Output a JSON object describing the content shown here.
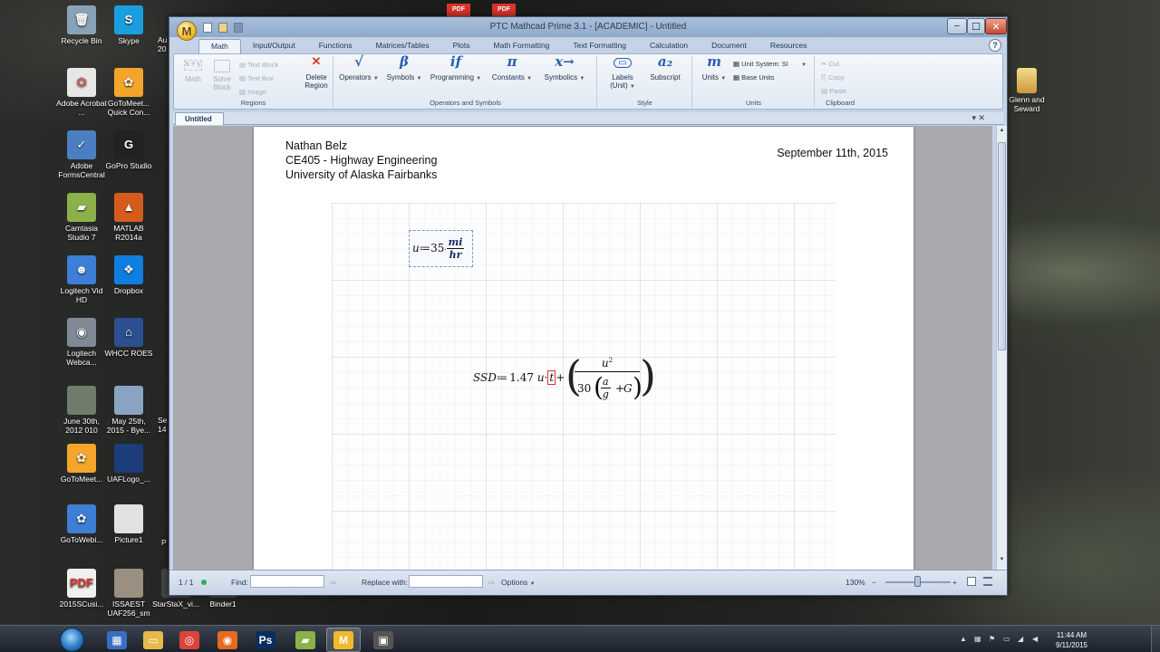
{
  "desktop_icons": [
    {
      "label": "Recycle Bin",
      "icon": "recycle-bin-icon",
      "color": "#8aa2b8",
      "glyph": "🗑"
    },
    {
      "label": "Skype",
      "icon": "skype-icon",
      "color": "#1b9ee0",
      "glyph": "S"
    },
    {
      "label": "Adobe Acrobat ...",
      "icon": "acrobat-icon",
      "color": "#e7e7e7",
      "glyph": "⏣"
    },
    {
      "label": "GoToMeet... Quick Con...",
      "icon": "gotomeeting-flower-icon",
      "color": "#f4a62a",
      "glyph": "✿"
    },
    {
      "label": "Adobe FormsCentral",
      "icon": "formscentral-icon",
      "color": "#4b7fc2",
      "glyph": "✓"
    },
    {
      "label": "GoPro Studio",
      "icon": "gopro-icon",
      "color": "#222222",
      "glyph": "G"
    },
    {
      "label": "Camtasia Studio 7",
      "icon": "camtasia-icon",
      "color": "#8cb04a",
      "glyph": "▰"
    },
    {
      "label": "MATLAB R2014a",
      "icon": "matlab-icon",
      "color": "#d65c1e",
      "glyph": "▲"
    },
    {
      "label": "Logitech Vid HD",
      "icon": "logitech-vid-icon",
      "color": "#3d7fd6",
      "glyph": "☻"
    },
    {
      "label": "Dropbox",
      "icon": "dropbox-icon",
      "color": "#0e7fe0",
      "glyph": "❖"
    },
    {
      "label": "Logitech Webca...",
      "icon": "webcam-icon",
      "color": "#7f8a96",
      "glyph": "◉"
    },
    {
      "label": "WHCC ROES",
      "icon": "whcc-roes-icon",
      "color": "#2b4f90",
      "glyph": "⌂"
    },
    {
      "label": "June 30th, 2012 010",
      "icon": "photo-thumbnail-icon",
      "color": "#6f7d6a",
      "glyph": ""
    },
    {
      "label": "May 25th, 2015 - Bye...",
      "icon": "photo-thumbnail-icon",
      "color": "#8aa3c0",
      "glyph": ""
    },
    {
      "label": "GoToMeet...",
      "icon": "gotomeeting-flower-icon",
      "color": "#f4a62a",
      "glyph": "✿"
    },
    {
      "label": "UAFLogo_...",
      "icon": "uaf-logo-icon",
      "color": "#1c3d7a",
      "glyph": ""
    },
    {
      "label": "GoToWebi...",
      "icon": "gotowebinar-icon",
      "color": "#3e7ed4",
      "glyph": "✿"
    },
    {
      "label": "Picture1",
      "icon": "picture-thumbnail-icon",
      "color": "#e2e2e2",
      "glyph": ""
    },
    {
      "label": "2015SCusi...",
      "icon": "pdf-file-icon",
      "color": "#f0f0f0",
      "glyph": "PDF"
    },
    {
      "label": "ISSAEST UAF256_sm",
      "icon": "person-photo-icon",
      "color": "#9a8f80",
      "glyph": ""
    },
    {
      "label": "StarStaX_vi...",
      "icon": "file-icon",
      "color": "#444444",
      "glyph": ""
    },
    {
      "label": "Binder1",
      "icon": "file-icon",
      "color": "#444444",
      "glyph": ""
    }
  ],
  "desktop_partial_labels": {
    "au": "Au",
    "num_20": "20",
    "se": "Se",
    "n14": "14",
    "p": "P"
  },
  "right_desktop_icon": {
    "label": "Glenn and Seward",
    "icon": "folder-icon"
  },
  "top_pdf_labels": [
    "PDF",
    "PDF"
  ],
  "window": {
    "title": "PTC Mathcad Prime 3.1 - [ACADEMIC] - Untitled",
    "logo_letter": "M",
    "help_glyph": "?",
    "controls": {
      "minimize": "−",
      "maximize": "☐",
      "close": "✕"
    },
    "tabs": [
      "Math",
      "Input/Output",
      "Functions",
      "Matrices/Tables",
      "Plots",
      "Math Formatting",
      "Text Formatting",
      "Calculation",
      "Document",
      "Resources"
    ],
    "active_tab": "Math"
  },
  "ribbon": {
    "regions": {
      "label": "Regions",
      "math": "Math",
      "solve_block": "Solve Block",
      "text_block": "Text Block",
      "text_box": "Text Box",
      "image": "Image",
      "delete_region": "Delete Region"
    },
    "operators": {
      "label": "Operators and Symbols",
      "operators": "Operators",
      "symbols": "Symbols",
      "programming": "Programming",
      "constants": "Constants",
      "symbolics": "Symbolics",
      "glyphs": {
        "operators": "√",
        "symbols": "β",
        "programming": "if",
        "constants": "π",
        "symbolics": "x→"
      }
    },
    "style": {
      "label": "Style",
      "labels": "Labels (Unit)",
      "subscript": "Subscript",
      "subscript_glyph": "a₂"
    },
    "units": {
      "label": "Units",
      "units": "Units",
      "units_glyph": "m",
      "unit_system": "Unit System:",
      "unit_system_value": "SI",
      "base_units": "Base Units"
    },
    "clipboard": {
      "label": "Clipboard",
      "cut": "Cut",
      "copy": "Copy",
      "paste": "Paste"
    }
  },
  "document": {
    "tab_name": "Untitled",
    "header_lines": [
      "Nathan Belz",
      "CE405 - Highway Engineering",
      "University of Alaska Fairbanks"
    ],
    "date": "September 11th, 2015",
    "math1": {
      "lhs": "u",
      "assign": "≔",
      "value": "35",
      "num": "mi",
      "den": "hr"
    },
    "math2": {
      "lhs": "SSD",
      "assign": "≔",
      "coef": "1.47",
      "var": "u",
      "cursor": "t",
      "plus": "+",
      "frac_num": "u",
      "exp": "2",
      "den_coef": "30",
      "a": "a",
      "g": "g",
      "G": "G"
    }
  },
  "statusbar": {
    "page": "1 / 1",
    "find": "Find:",
    "replace": "Replace with:",
    "options": "Options",
    "zoom": "130%",
    "zoom_minus": "−",
    "zoom_plus": "+"
  },
  "taskbar": {
    "time": "11:44 AM",
    "date": "9/11/2015",
    "apps": [
      {
        "name": "explorer-icon",
        "glyph": "▦",
        "color": "#3a6fbf"
      },
      {
        "name": "folder-icon",
        "glyph": "▭",
        "color": "#e6b94a"
      },
      {
        "name": "chrome-icon",
        "glyph": "◎",
        "color": "#db4437"
      },
      {
        "name": "firefox-icon",
        "glyph": "◉",
        "color": "#e66a1f"
      },
      {
        "name": "photoshop-icon",
        "glyph": "Ps",
        "color": "#0a2e5b"
      },
      {
        "name": "camtasia-icon",
        "glyph": "▰",
        "color": "#8cb04a"
      },
      {
        "name": "mathcad-icon",
        "glyph": "M",
        "color": "#f1b92c"
      },
      {
        "name": "device-icon",
        "glyph": "▣",
        "color": "#555555"
      }
    ]
  }
}
